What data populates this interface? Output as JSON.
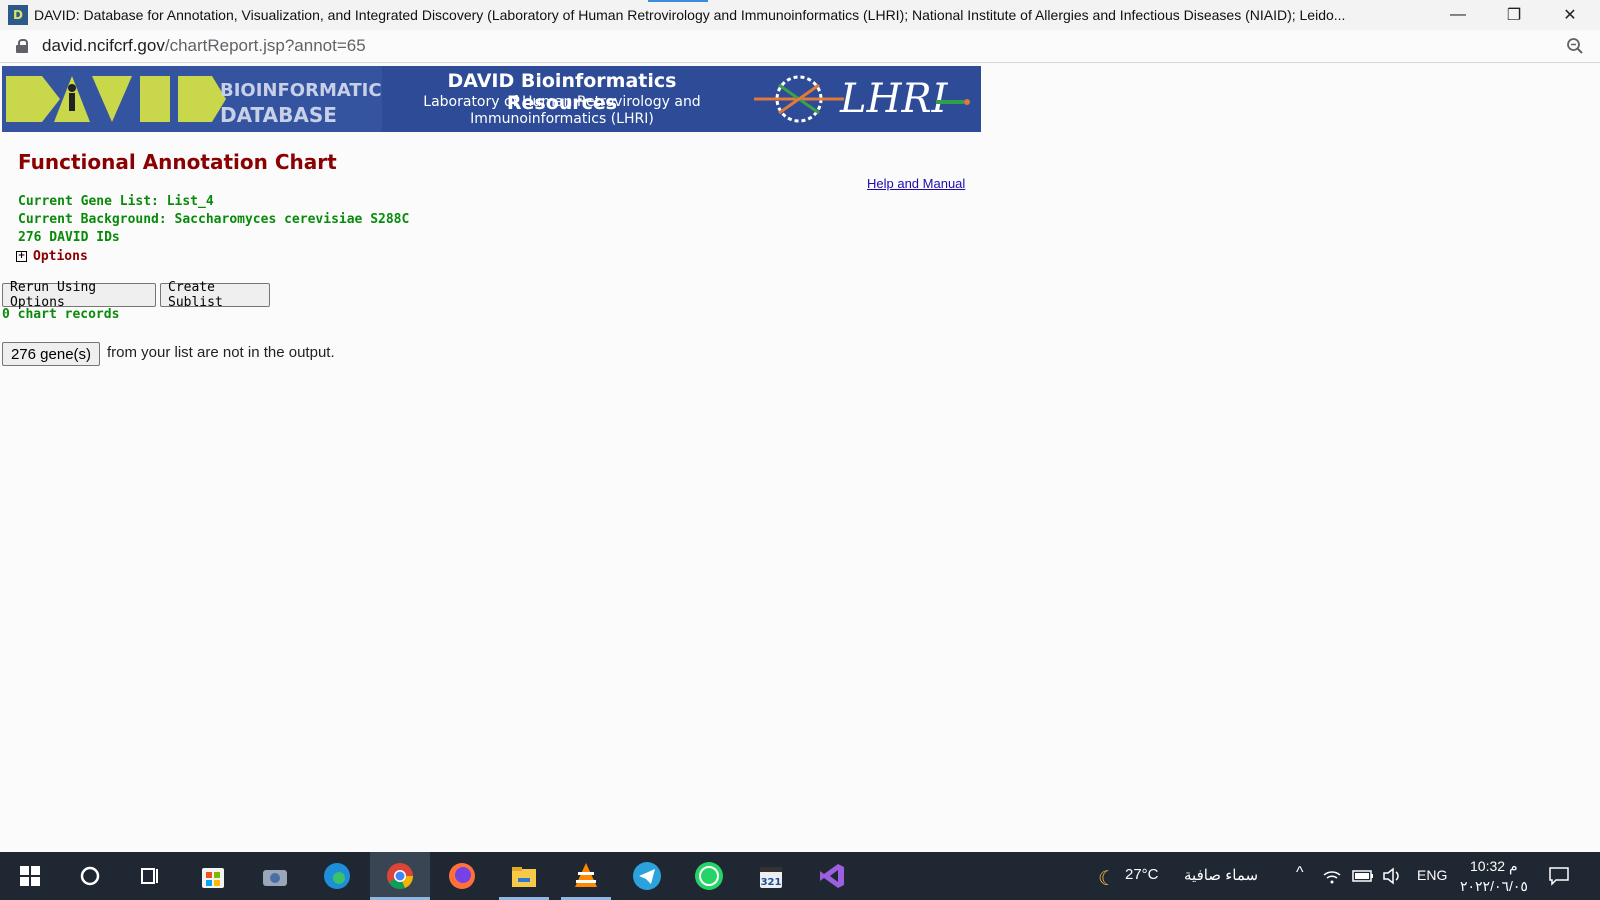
{
  "window": {
    "title": "DAVID: Database for Annotation, Visualization, and Integrated Discovery (Laboratory of Human Retrovirology and Immunoinformatics (LHRI); National Institute of Allergies and Infectious Diseases (NIAID); Leido...",
    "minimize_glyph": "—",
    "maximize_glyph": "❐",
    "close_glyph": "✕"
  },
  "address_bar": {
    "domain": "david.ncifcrf.gov",
    "path": "/chartReport.jsp?annot=65"
  },
  "banner": {
    "title": "DAVID Bioinformatics Resources",
    "subtitle_line1": "Laboratory of Human Retrovirology and",
    "subtitle_line2": "Immunoinformatics (LHRI)",
    "lhri_logo_text": "LHRI",
    "david_logo_text": "DAVID",
    "bioinformatics_text": "BIOINFORMATICS",
    "database_text": "DATABASE"
  },
  "page": {
    "title": "Functional Annotation Chart",
    "help_link": "Help and Manual",
    "gene_list": "Current Gene List: List_4",
    "background": "Current Background: Saccharomyces cerevisiae S288C",
    "david_ids": "276 DAVID IDs",
    "options_label": "Options",
    "rerun_button": "Rerun Using Options",
    "sublist_button": "Create Sublist",
    "chart_records": "0 chart records",
    "genes_button": "276 gene(s)",
    "genes_text": "from your list are not in the output."
  },
  "taskbar": {
    "weather_temp": "27°C",
    "weather_desc": "سماء صافية",
    "language": "ENG",
    "time": "10:32 م",
    "date": "٢٠٢٢/٠٦/٠٥",
    "icons": [
      "windows-start-icon",
      "cortana-search-icon",
      "task-view-icon",
      "microsoft-store-icon",
      "camera-icon",
      "edge-icon",
      "chrome-icon",
      "firefox-icon",
      "file-explorer-icon",
      "vlc-icon",
      "telegram-icon",
      "whatsapp-icon",
      "clipchamp-icon",
      "visual-studio-icon"
    ]
  },
  "colors": {
    "title_red": "#8b0000",
    "info_green": "#0a8a0a",
    "banner_blue": "#2d4b96",
    "taskbar": "#1f2733"
  }
}
